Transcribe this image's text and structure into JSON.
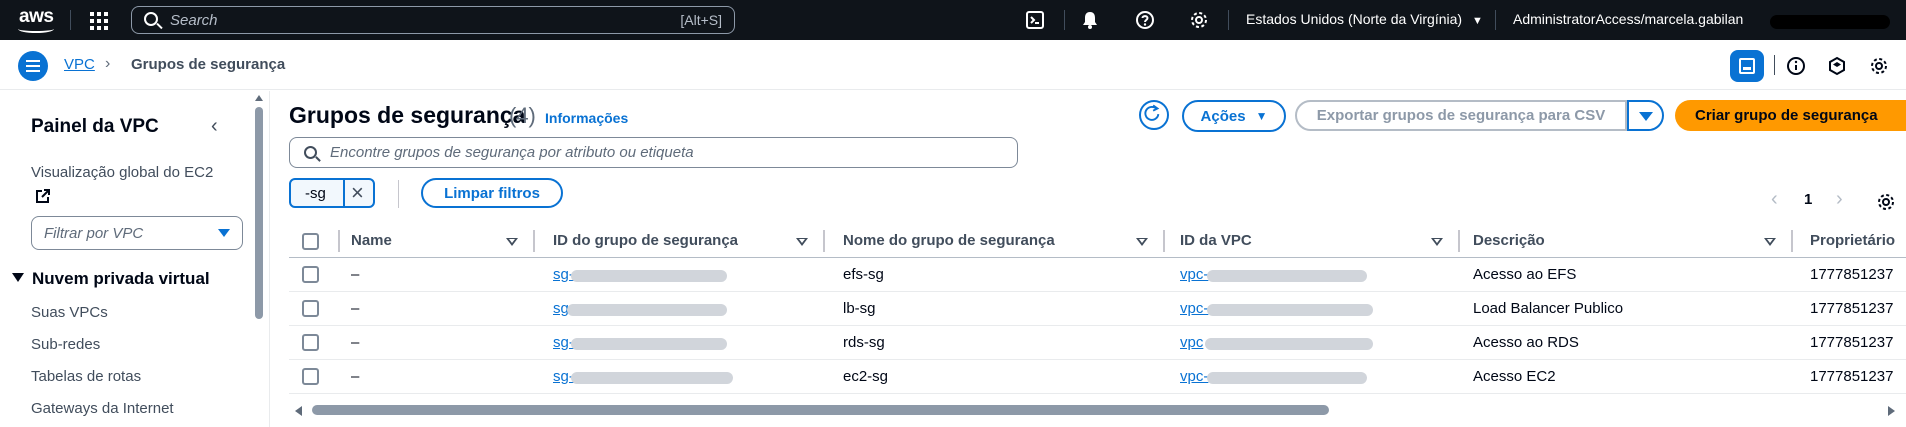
{
  "topbar": {
    "logo": "aws",
    "search_placeholder": "Search",
    "search_shortcut": "[Alt+S]",
    "region": "Estados Unidos (Norte da Virgínia)",
    "account": "AdministratorAccess/marcela.gabilan",
    "icons": [
      "cloudshell-icon",
      "bell-icon",
      "help-icon",
      "settings-icon"
    ]
  },
  "breadcrumb": {
    "root": "VPC",
    "current": "Grupos de segurança"
  },
  "sidebar": {
    "title": "Painel da VPC",
    "global_view": "Visualização global do EC2",
    "filter_placeholder": "Filtrar por VPC",
    "section": "Nuvem privada virtual",
    "items": [
      "Suas VPCs",
      "Sub-redes",
      "Tabelas de rotas",
      "Gateways da Internet"
    ]
  },
  "main": {
    "title": "Grupos de segurança",
    "count": "(4)",
    "info": "Informações",
    "actions_label": "Ações",
    "export_label": "Exportar grupos de segurança para CSV",
    "create_label": "Criar grupo de segurança",
    "search_placeholder": "Encontre grupos de segurança por atributo ou etiqueta",
    "filter_token": "-sg",
    "clear_filters": "Limpar filtros",
    "page": "1"
  },
  "table": {
    "columns": [
      "Name",
      "ID do grupo de segurança",
      "Nome do grupo de segurança",
      "ID da VPC",
      "Descrição",
      "Proprietário"
    ],
    "rows": [
      {
        "name": "–",
        "sg_id": "sg-",
        "sg_name": "efs-sg",
        "vpc_id": "vpc-",
        "desc": "Acesso ao EFS",
        "owner": "1777851237"
      },
      {
        "name": "–",
        "sg_id": "sg",
        "sg_name": "lb-sg",
        "vpc_id": "vpc-",
        "desc": "Load Balancer Publico",
        "owner": "1777851237"
      },
      {
        "name": "–",
        "sg_id": "sg-",
        "sg_name": "rds-sg",
        "vpc_id": "vpc",
        "desc": "Acesso ao RDS",
        "owner": "1777851237"
      },
      {
        "name": "–",
        "sg_id": "sg-",
        "sg_name": "ec2-sg",
        "vpc_id": "vpc-",
        "desc": "Acesso EC2",
        "owner": "1777851237"
      }
    ]
  },
  "colors": {
    "topbar_bg": "#0f141a",
    "accent": "#0972d3",
    "primary_button": "#ff9900"
  }
}
